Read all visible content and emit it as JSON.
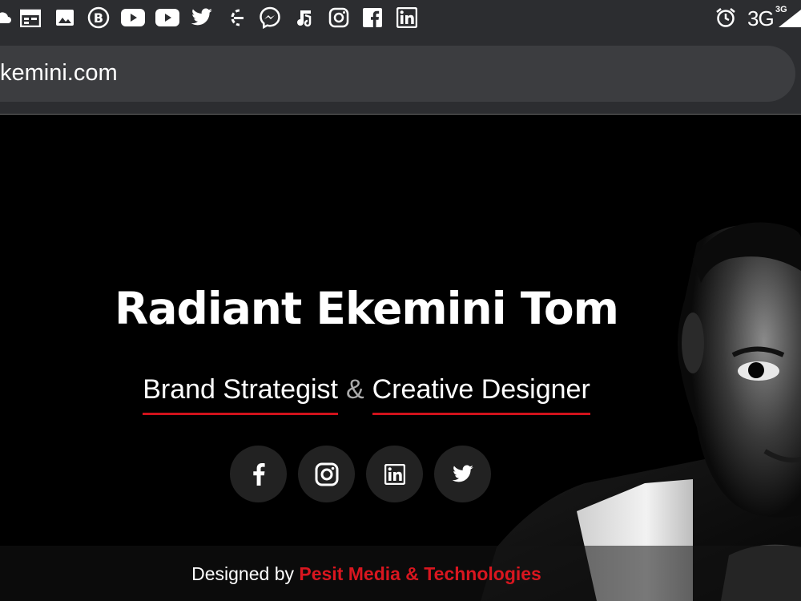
{
  "status_bar": {
    "left_icons": [
      "cloud-icon",
      "calendar-icon",
      "image-icon",
      "b-circle-icon",
      "youtube-icon",
      "youtube-icon",
      "twitter-icon",
      "ubuntu-like-icon",
      "messenger-icon",
      "music-icon",
      "instagram-icon",
      "facebook-icon",
      "linkedin-icon"
    ],
    "alarm_icon": "alarm-icon",
    "network_label": "3G",
    "network_sup": "3G",
    "signal_icon": "signal-icon"
  },
  "browser": {
    "url": "kemini.com"
  },
  "hero": {
    "name": "Radiant Ekemini Tom",
    "role_left": "Brand Strategist",
    "role_amp": "&",
    "role_right": "Creative Designer"
  },
  "socials": [
    {
      "name": "facebook",
      "icon": "facebook-icon"
    },
    {
      "name": "instagram",
      "icon": "instagram-icon"
    },
    {
      "name": "linkedin",
      "icon": "linkedin-icon"
    },
    {
      "name": "twitter",
      "icon": "twitter-icon"
    }
  ],
  "footer": {
    "prefix": "Designed by ",
    "brand": "Pesit Media & Technologies"
  },
  "colors": {
    "accent_red": "#d0121b",
    "background": "#000000",
    "chrome": "#2c2d30"
  }
}
